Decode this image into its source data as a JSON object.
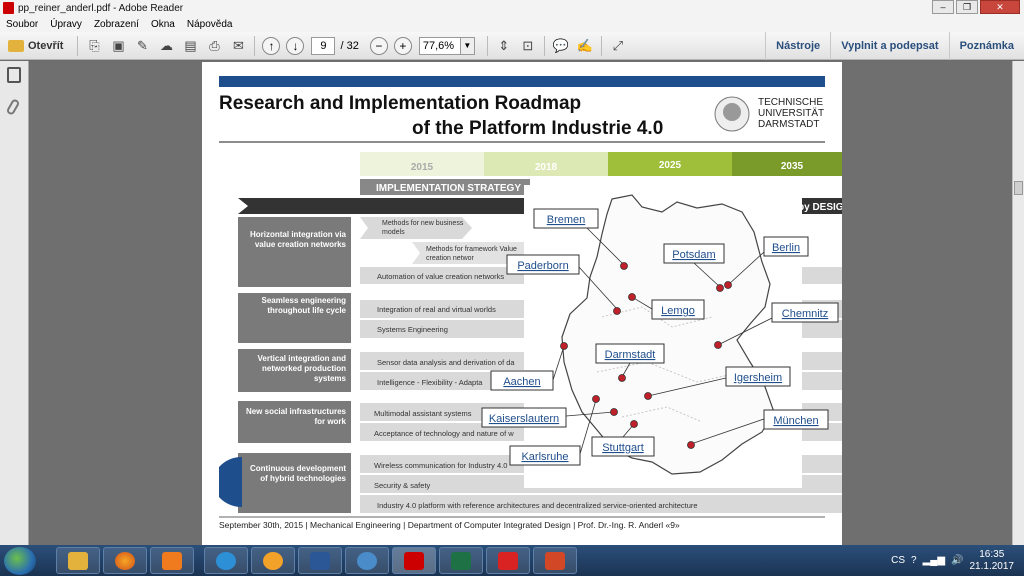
{
  "window": {
    "title": "pp_reiner_anderl.pdf - Adobe Reader"
  },
  "menu": [
    "Soubor",
    "Úpravy",
    "Zobrazení",
    "Okna",
    "Nápověda"
  ],
  "toolbar": {
    "open_label": "Otevřít",
    "page_current": "9",
    "page_total": "/ 32",
    "zoom": "77,6%",
    "right_links": [
      "Nástroje",
      "Vyplnit a podepsat",
      "Poznámka"
    ]
  },
  "slide": {
    "title_line1": "Research and Implementation Roadmap",
    "title_line2": "of the Platform Industrie 4.0",
    "university": [
      "TECHNISCHE",
      "UNIVERSITÄT",
      "DARMSTADT"
    ],
    "years": [
      "2015",
      "2018",
      "2025",
      "2035"
    ],
    "strategy_label": "IMPLEMENTATION STRATEGY",
    "design_label": "by DESIG",
    "categories": [
      "Horizontal integration via value creation networks",
      "Seamless engineering throughout life cycle",
      "Vertical integration and networked production systems",
      "New social infrastructures for work",
      "Continuous development of hybrid technologies"
    ],
    "rows": [
      "Methods for new business models",
      "Methods for framework Value creation networ",
      "Automation of value creation networks",
      "Integration of real and virtual worlds",
      "Systems Engineering",
      "Sensor data analysis and derivation of da",
      "Intelligence - Flexibility - Adapta",
      "Multimodal assistant systems",
      "Acceptance of technology and nature of w",
      "Wireless communication for Industry 4.0",
      "Security & safety",
      "Industry 4.0 platform with reference architectures and decentralized service-oriented architecture"
    ],
    "cities": [
      "Bremen",
      "Berlin",
      "Potsdam",
      "Paderborn",
      "Lemgo",
      "Chemnitz",
      "Darmstadt",
      "Aachen",
      "Igersheim",
      "Kaiserslautern",
      "München",
      "Stuttgart",
      "Karlsruhe"
    ],
    "footer": "September 30th, 2015  |  Mechanical Engineering  |  Department of Computer Integrated Design  |  Prof. Dr.-Ing. R. Anderl  «9»"
  },
  "tray": {
    "lang": "CS",
    "time": "16:35",
    "date": "21.1.2017"
  },
  "colors": {
    "accent_blue": "#1f4e8c",
    "green_light": "#9fbf3a",
    "green_dark": "#7a9a2a",
    "dot_red": "#c0202a"
  }
}
